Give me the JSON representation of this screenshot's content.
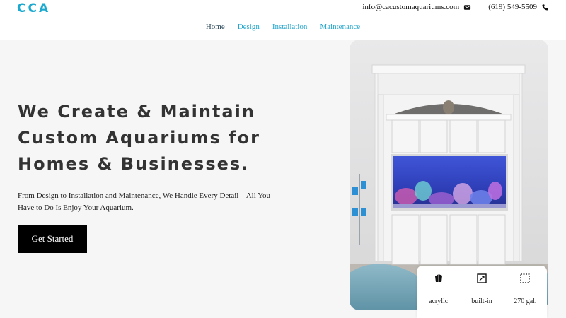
{
  "brand": {
    "logo_text": "CCA",
    "accent": "#1ba9cf"
  },
  "contact": {
    "email": "info@cacustomaquariums.com",
    "email_icon": "mail-icon",
    "phone": "(619) 549-5509",
    "phone_icon": "phone-icon"
  },
  "nav": {
    "items": [
      {
        "label": "Home",
        "active": true
      },
      {
        "label": "Design"
      },
      {
        "label": "Installation"
      },
      {
        "label": "Maintenance"
      }
    ]
  },
  "hero": {
    "title_lines": [
      "We Create & Maintain",
      "Custom Aquariums for",
      "Homes & Businesses."
    ],
    "subtitle": "From Design to Installation and Maintenance, We Handle Every Detail – All You Have to Do Is Enjoy Your Aquarium.",
    "cta_label": "Get Started"
  },
  "features": [
    {
      "label": "acrylic",
      "icon": "acrylic-icon"
    },
    {
      "label": "built-in",
      "icon": "built-in-icon"
    },
    {
      "label": "270 gal.",
      "icon": "capacity-icon"
    }
  ]
}
